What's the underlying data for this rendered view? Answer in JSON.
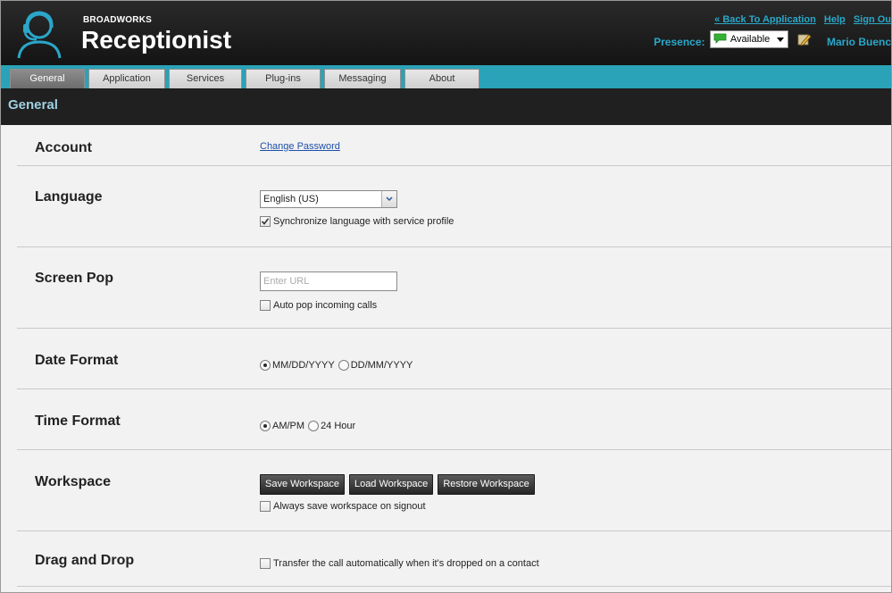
{
  "header": {
    "brand_small": "BROADWORKS",
    "brand_big": "Receptionist",
    "links": {
      "back": "« Back To Application",
      "help": "Help",
      "sign_out": "Sign Ou"
    },
    "presence_label": "Presence:",
    "presence_value": "Available",
    "user_name": "Mario Buenc"
  },
  "tabs": [
    "General",
    "Application",
    "Services",
    "Plug-ins",
    "Messaging",
    "About"
  ],
  "active_tab": "General",
  "section_title": "General",
  "rows": {
    "account": {
      "label": "Account",
      "link": "Change Password"
    },
    "language": {
      "label": "Language",
      "select_value": "English (US)",
      "checkbox_label": "Synchronize language with service profile",
      "checkbox_checked": true
    },
    "screen_pop": {
      "label": "Screen Pop",
      "url_placeholder": "Enter URL",
      "checkbox_label": "Auto pop incoming calls",
      "checkbox_checked": false
    },
    "date_format": {
      "label": "Date Format",
      "options": [
        "MM/DD/YYYY",
        "DD/MM/YYYY"
      ],
      "selected": "MM/DD/YYYY"
    },
    "time_format": {
      "label": "Time Format",
      "options": [
        "AM/PM",
        "24 Hour"
      ],
      "selected": "AM/PM"
    },
    "workspace": {
      "label": "Workspace",
      "buttons": [
        "Save Workspace",
        "Load Workspace",
        "Restore Workspace"
      ],
      "checkbox_label": "Always save workspace on signout",
      "checkbox_checked": false
    },
    "drag_drop": {
      "label": "Drag and Drop",
      "checkbox_label": "Transfer the call automatically when it's dropped on a contact",
      "checkbox_checked": false
    }
  },
  "colors": {
    "accent": "#2aa7c9",
    "tab_strip": "#2aa2b8",
    "header_bg": "#1a1a1a",
    "section_title": "#9fd0e0",
    "presence_green": "#35b035"
  }
}
